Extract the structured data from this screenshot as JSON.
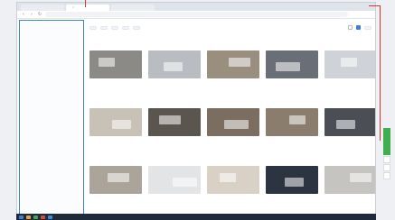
{
  "browser": {
    "tabs": [
      "",
      "",
      ""
    ],
    "url": ""
  },
  "breadcrumb": {
    "root": "",
    "current": ""
  },
  "section": {
    "title": "",
    "count": ""
  },
  "filters": [
    "",
    "",
    "",
    "",
    ""
  ],
  "sort_label": "",
  "sidebar": {
    "categories": [
      {
        "title": "",
        "sub": ""
      },
      {
        "title": "",
        "sub": ""
      },
      {
        "title": "",
        "sub": ""
      },
      {
        "title": "",
        "sub": ""
      },
      {
        "title": "",
        "sub": ""
      },
      {
        "title": "",
        "sub": ""
      },
      {
        "title": "",
        "sub": ""
      },
      {
        "title": "",
        "sub": ""
      },
      {
        "title": "",
        "sub": ""
      },
      {
        "title": "",
        "sub": ""
      },
      {
        "title": "",
        "sub": ""
      }
    ]
  },
  "cards": [
    {
      "title": "",
      "author": "",
      "date": "",
      "rating": "",
      "stars": "",
      "thumb": "#8c8a86"
    },
    {
      "title": "",
      "author": "",
      "date": "",
      "rating": "",
      "stars": "",
      "thumb": "#b9bcc0"
    },
    {
      "title": "",
      "author": "",
      "date": "",
      "rating": "",
      "stars": "",
      "thumb": "#9a8f7e"
    },
    {
      "title": "",
      "author": "",
      "date": "",
      "rating": "",
      "stars": "",
      "thumb": "#6a6f77"
    },
    {
      "title": "",
      "author": "",
      "date": "",
      "rating": "",
      "stars": "",
      "thumb": "#cfd3d8"
    },
    {
      "title": "",
      "author": "",
      "date": "",
      "rating": "",
      "stars": "",
      "thumb": "#c7c1b6"
    },
    {
      "title": "",
      "author": "",
      "date": "",
      "rating": "",
      "stars": "",
      "thumb": "#5b5550"
    },
    {
      "title": "",
      "author": "",
      "date": "",
      "rating": "",
      "stars": "",
      "thumb": "#7b6d60"
    },
    {
      "title": "",
      "author": "",
      "date": "",
      "rating": "",
      "stars": "",
      "thumb": "#8b7d6e"
    },
    {
      "title": "",
      "author": "",
      "date": "",
      "rating": "",
      "stars": "",
      "thumb": "#4b4f55"
    },
    {
      "title": "",
      "author": "",
      "date": "",
      "rating": "",
      "stars": "",
      "thumb": "#aaa49a"
    },
    {
      "title": "",
      "author": "",
      "date": "",
      "rating": "",
      "stars": "",
      "thumb": "#e3e4e6"
    },
    {
      "title": "",
      "author": "",
      "date": "",
      "rating": "",
      "stars": "",
      "thumb": "#d9d1c5"
    },
    {
      "title": "",
      "author": "",
      "date": "",
      "rating": "",
      "stars": "",
      "thumb": "#2c3442"
    },
    {
      "title": "",
      "author": "",
      "date": "",
      "rating": "",
      "stars": "",
      "thumb": "#c6c4c0"
    }
  ],
  "rightrail": {
    "label": ""
  },
  "colors": {
    "accent": "#3f7fd6",
    "rail": "#3fae4f",
    "taskbar": "#1f2b3a",
    "marker": "#e0312f"
  }
}
